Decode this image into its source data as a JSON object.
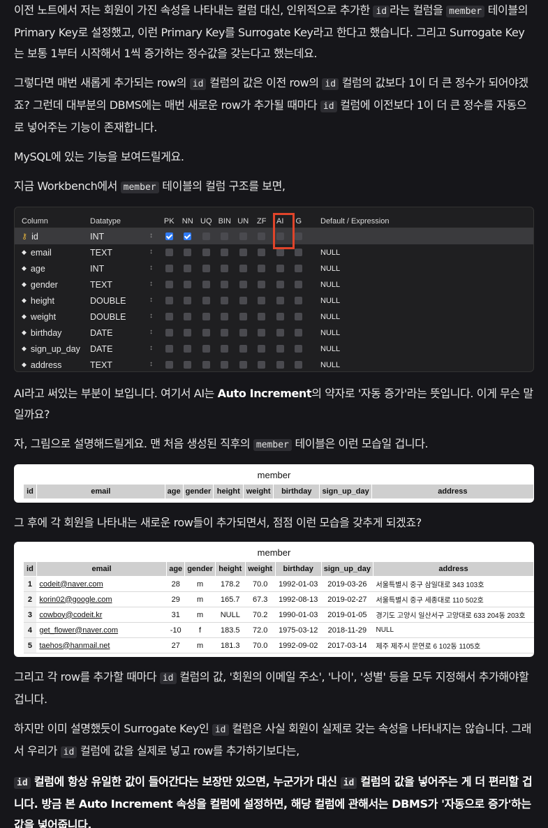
{
  "p1": {
    "a": "이전 노트에서 저는 회원이 가진 속성을 나타내는 컬럼 대신, 인위적으로 추가한 ",
    "c1": "id",
    "b": "라는 컬럼을 ",
    "c2": "member",
    "c": " 테이블의 Primary Key로 설정했고, 이런 Primary Key를 Surrogate Key라고 한다고 했습니다. 그리고 Surrogate Key는 보통 1부터 시작해서 1씩 증가하는 정수값을 갖는다고 했는데요."
  },
  "p2": {
    "a": "그렇다면 매번 새롭게 추가되는 row의 ",
    "c1": "id",
    "b": " 컬럼의 값은 이전 row의 ",
    "c2": "id",
    "c": " 컬럼의 값보다 1이 더 큰 정수가 되어야겠죠? 그런데 대부분의 DBMS에는 매번 새로운 row가 추가될 때마다 ",
    "c3": "id",
    "d": " 컬럼에 이전보다 1이 더 큰 정수를 자동으로 넣어주는 기능이 존재합니다."
  },
  "p3": "MySQL에 있는 기능을 보여드릴게요.",
  "p4": {
    "a": "지금 Workbench에서 ",
    "c1": "member",
    "b": " 테이블의 컬럼 구조를 보면,"
  },
  "workbench": {
    "headers": [
      "Column",
      "Datatype",
      "PK",
      "NN",
      "UQ",
      "BIN",
      "UN",
      "ZF",
      "AI",
      "G",
      "Default / Expression"
    ],
    "rows": [
      {
        "name": "id",
        "type": "INT",
        "pk": true,
        "nn": true,
        "default": "",
        "icon": "key-icon"
      },
      {
        "name": "email",
        "type": "TEXT",
        "pk": false,
        "nn": false,
        "default": "NULL",
        "icon": "diamond-icon"
      },
      {
        "name": "age",
        "type": "INT",
        "pk": false,
        "nn": false,
        "default": "NULL",
        "icon": "diamond-icon"
      },
      {
        "name": "gender",
        "type": "TEXT",
        "pk": false,
        "nn": false,
        "default": "NULL",
        "icon": "diamond-icon"
      },
      {
        "name": "height",
        "type": "DOUBLE",
        "pk": false,
        "nn": false,
        "default": "NULL",
        "icon": "diamond-icon"
      },
      {
        "name": "weight",
        "type": "DOUBLE",
        "pk": false,
        "nn": false,
        "default": "NULL",
        "icon": "diamond-icon"
      },
      {
        "name": "birthday",
        "type": "DATE",
        "pk": false,
        "nn": false,
        "default": "NULL",
        "icon": "diamond-icon"
      },
      {
        "name": "sign_up_day",
        "type": "DATE",
        "pk": false,
        "nn": false,
        "default": "NULL",
        "icon": "diamond-icon"
      },
      {
        "name": "address",
        "type": "TEXT",
        "pk": false,
        "nn": false,
        "default": "NULL",
        "icon": "diamond-icon"
      }
    ],
    "highlight_color": "#e0442a"
  },
  "p5": {
    "a": "AI라고 써있는 부분이 보입니다. 여기서 AI는 ",
    "b1": "Auto Increment",
    "b": "의 약자로 '자동 증가'라는 뜻입니다. 이게 무슨 말일까요?"
  },
  "p6": {
    "a": "자, 그림으로 설명해드릴게요. 맨 처음 생성된 직후의 ",
    "c1": "member",
    "b": " 테이블은 이런 모습일 겁니다."
  },
  "empty_table": {
    "title": "member",
    "headers": [
      "id",
      "email",
      "age",
      "gender",
      "height",
      "weight",
      "birthday",
      "sign_up_day",
      "address"
    ]
  },
  "p7": "그 후에 각 회원을 나타내는 새로운 row들이 추가되면서, 점점 이런 모습을 갖추게 되겠죠?",
  "full_table": {
    "title": "member",
    "headers": [
      "id",
      "email",
      "age",
      "gender",
      "height",
      "weight",
      "birthday",
      "sign_up_day",
      "address"
    ],
    "rows": [
      [
        "1",
        "codeit@naver.com",
        "28",
        "m",
        "178.2",
        "70.0",
        "1992-01-03",
        "2019-03-26",
        "서울특별시 중구 삼일대로 343 103호"
      ],
      [
        "2",
        "korin02@google.com",
        "29",
        "m",
        "165.7",
        "67.3",
        "1992-08-13",
        "2019-02-27",
        "서울특별시 중구 세종대로 110 502호"
      ],
      [
        "3",
        "cowboy@codeit.kr",
        "31",
        "m",
        "NULL",
        "70.2",
        "1990-01-03",
        "2019-01-05",
        "경기도 고양시 일산서구 고양대로 633 204동 203호"
      ],
      [
        "4",
        "get_flower@naver.com",
        "-10",
        "f",
        "183.5",
        "72.0",
        "1975-03-12",
        "2018-11-29",
        "NULL"
      ],
      [
        "5",
        "taehos@hanmail.net",
        "27",
        "m",
        "181.3",
        "70.0",
        "1992-09-02",
        "2017-03-14",
        "제주 제주시 문연로 6 102동 1105호"
      ]
    ]
  },
  "p8": {
    "a": "그리고 각 row를 추가할 때마다 ",
    "c1": "id",
    "b": " 컬럼의 값, '회원의 이메일 주소', '나이', '성별' 등을 모두 지정해서 추가해야할 겁니다."
  },
  "p9": {
    "a": "하지만 이미 설명했듯이 Surrogate Key인 ",
    "c1": "id",
    "b": " 컬럼은 사실 회원이 실제로 갖는 속성을 나타내지는 않습니다. 그래서 우리가 ",
    "c2": "id",
    "c": " 컬럼에 값을 실제로 넣고 row를 추가하기보다는,"
  },
  "p10": {
    "c1": "id",
    "a": " 컬럼에 항상 유일한 값이 들어간다는 보장만 있으면, 누군가가 대신 ",
    "c2": "id",
    "b": " 컬럼의 값을 넣어주는 게 더 편리할 겁니다. 방금 본 Auto Increment 속성을 컬럼에 설정하면, 해당 컬럼에 관해서는 DBMS가 '자동으로 증가'하는 값을 넣어줍니다."
  }
}
